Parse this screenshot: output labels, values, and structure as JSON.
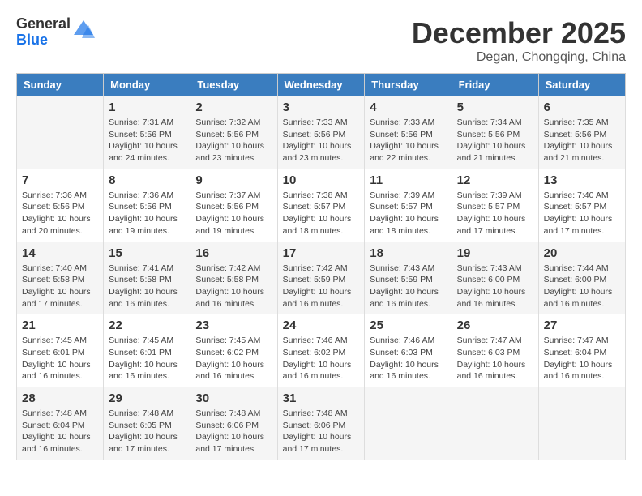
{
  "logo": {
    "general": "General",
    "blue": "Blue"
  },
  "title": "December 2025",
  "subtitle": "Degan, Chongqing, China",
  "headers": [
    "Sunday",
    "Monday",
    "Tuesday",
    "Wednesday",
    "Thursday",
    "Friday",
    "Saturday"
  ],
  "weeks": [
    [
      {
        "day": "",
        "info": ""
      },
      {
        "day": "1",
        "info": "Sunrise: 7:31 AM\nSunset: 5:56 PM\nDaylight: 10 hours\nand 24 minutes."
      },
      {
        "day": "2",
        "info": "Sunrise: 7:32 AM\nSunset: 5:56 PM\nDaylight: 10 hours\nand 23 minutes."
      },
      {
        "day": "3",
        "info": "Sunrise: 7:33 AM\nSunset: 5:56 PM\nDaylight: 10 hours\nand 23 minutes."
      },
      {
        "day": "4",
        "info": "Sunrise: 7:33 AM\nSunset: 5:56 PM\nDaylight: 10 hours\nand 22 minutes."
      },
      {
        "day": "5",
        "info": "Sunrise: 7:34 AM\nSunset: 5:56 PM\nDaylight: 10 hours\nand 21 minutes."
      },
      {
        "day": "6",
        "info": "Sunrise: 7:35 AM\nSunset: 5:56 PM\nDaylight: 10 hours\nand 21 minutes."
      }
    ],
    [
      {
        "day": "7",
        "info": "Sunrise: 7:36 AM\nSunset: 5:56 PM\nDaylight: 10 hours\nand 20 minutes."
      },
      {
        "day": "8",
        "info": "Sunrise: 7:36 AM\nSunset: 5:56 PM\nDaylight: 10 hours\nand 19 minutes."
      },
      {
        "day": "9",
        "info": "Sunrise: 7:37 AM\nSunset: 5:56 PM\nDaylight: 10 hours\nand 19 minutes."
      },
      {
        "day": "10",
        "info": "Sunrise: 7:38 AM\nSunset: 5:57 PM\nDaylight: 10 hours\nand 18 minutes."
      },
      {
        "day": "11",
        "info": "Sunrise: 7:39 AM\nSunset: 5:57 PM\nDaylight: 10 hours\nand 18 minutes."
      },
      {
        "day": "12",
        "info": "Sunrise: 7:39 AM\nSunset: 5:57 PM\nDaylight: 10 hours\nand 17 minutes."
      },
      {
        "day": "13",
        "info": "Sunrise: 7:40 AM\nSunset: 5:57 PM\nDaylight: 10 hours\nand 17 minutes."
      }
    ],
    [
      {
        "day": "14",
        "info": "Sunrise: 7:40 AM\nSunset: 5:58 PM\nDaylight: 10 hours\nand 17 minutes."
      },
      {
        "day": "15",
        "info": "Sunrise: 7:41 AM\nSunset: 5:58 PM\nDaylight: 10 hours\nand 16 minutes."
      },
      {
        "day": "16",
        "info": "Sunrise: 7:42 AM\nSunset: 5:58 PM\nDaylight: 10 hours\nand 16 minutes."
      },
      {
        "day": "17",
        "info": "Sunrise: 7:42 AM\nSunset: 5:59 PM\nDaylight: 10 hours\nand 16 minutes."
      },
      {
        "day": "18",
        "info": "Sunrise: 7:43 AM\nSunset: 5:59 PM\nDaylight: 10 hours\nand 16 minutes."
      },
      {
        "day": "19",
        "info": "Sunrise: 7:43 AM\nSunset: 6:00 PM\nDaylight: 10 hours\nand 16 minutes."
      },
      {
        "day": "20",
        "info": "Sunrise: 7:44 AM\nSunset: 6:00 PM\nDaylight: 10 hours\nand 16 minutes."
      }
    ],
    [
      {
        "day": "21",
        "info": "Sunrise: 7:45 AM\nSunset: 6:01 PM\nDaylight: 10 hours\nand 16 minutes."
      },
      {
        "day": "22",
        "info": "Sunrise: 7:45 AM\nSunset: 6:01 PM\nDaylight: 10 hours\nand 16 minutes."
      },
      {
        "day": "23",
        "info": "Sunrise: 7:45 AM\nSunset: 6:02 PM\nDaylight: 10 hours\nand 16 minutes."
      },
      {
        "day": "24",
        "info": "Sunrise: 7:46 AM\nSunset: 6:02 PM\nDaylight: 10 hours\nand 16 minutes."
      },
      {
        "day": "25",
        "info": "Sunrise: 7:46 AM\nSunset: 6:03 PM\nDaylight: 10 hours\nand 16 minutes."
      },
      {
        "day": "26",
        "info": "Sunrise: 7:47 AM\nSunset: 6:03 PM\nDaylight: 10 hours\nand 16 minutes."
      },
      {
        "day": "27",
        "info": "Sunrise: 7:47 AM\nSunset: 6:04 PM\nDaylight: 10 hours\nand 16 minutes."
      }
    ],
    [
      {
        "day": "28",
        "info": "Sunrise: 7:48 AM\nSunset: 6:04 PM\nDaylight: 10 hours\nand 16 minutes."
      },
      {
        "day": "29",
        "info": "Sunrise: 7:48 AM\nSunset: 6:05 PM\nDaylight: 10 hours\nand 17 minutes."
      },
      {
        "day": "30",
        "info": "Sunrise: 7:48 AM\nSunset: 6:06 PM\nDaylight: 10 hours\nand 17 minutes."
      },
      {
        "day": "31",
        "info": "Sunrise: 7:48 AM\nSunset: 6:06 PM\nDaylight: 10 hours\nand 17 minutes."
      },
      {
        "day": "",
        "info": ""
      },
      {
        "day": "",
        "info": ""
      },
      {
        "day": "",
        "info": ""
      }
    ]
  ]
}
